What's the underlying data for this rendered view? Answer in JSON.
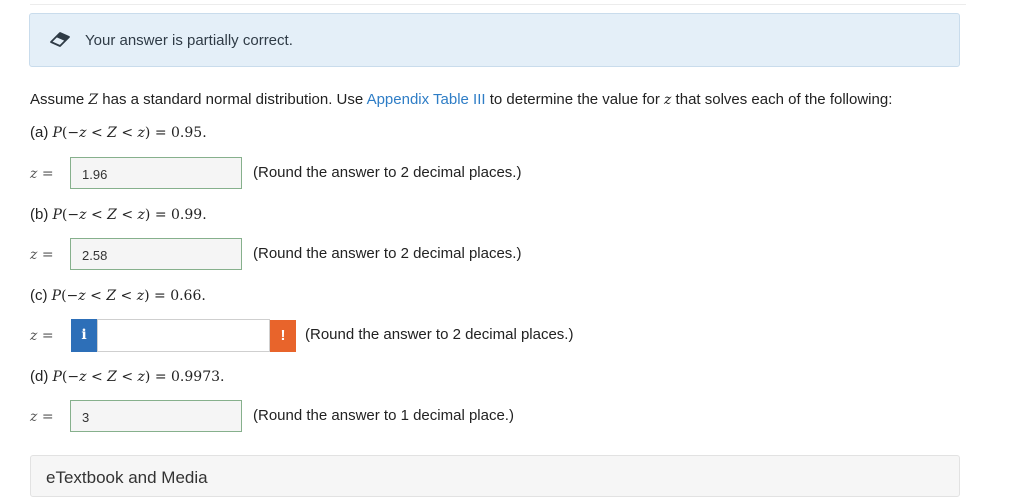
{
  "banner": {
    "text": "Your answer is partially correct.",
    "icon": "eraser-icon"
  },
  "question": {
    "intro_1": "Assume ",
    "intro_var": "Z",
    "intro_2": " has a standard normal distribution. Use ",
    "link": "Appendix Table III",
    "intro_3": " to determine the value for ",
    "intro_var2": "z",
    "intro_4": " that solves each of the following:"
  },
  "parts": [
    {
      "label": "(a) ",
      "prob": "0.95.",
      "z_label": "=",
      "answer": "1.96",
      "hint": "(Round the answer to 2 decimal places.)"
    },
    {
      "label": "(b) ",
      "prob": "0.99.",
      "z_label": "=",
      "answer": "2.58",
      "hint": "(Round the answer to 2 decimal places.)"
    },
    {
      "label": "(c) ",
      "prob": "0.66.",
      "z_label": "=",
      "answer": "",
      "hint": "(Round the answer to 2 decimal places.)",
      "info": "i",
      "warning": "!"
    },
    {
      "label": "(d) ",
      "prob": "0.9973.",
      "z_label": "=",
      "answer": "3",
      "hint": "(Round the answer to 1 decimal place.)"
    }
  ],
  "etextbook": "eTextbook and Media",
  "colors": {
    "banner_bg": "#e4eff8",
    "link": "#2e7dc6",
    "info": "#2d6fb8",
    "warning": "#e8642b",
    "correct_border": "#86b08c"
  }
}
